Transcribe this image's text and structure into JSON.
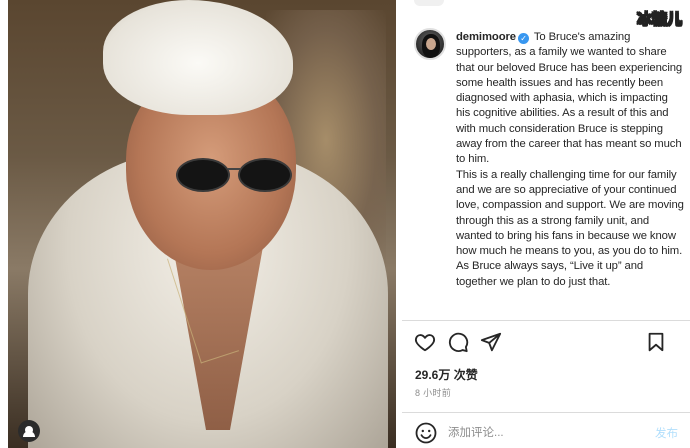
{
  "watermark": "冰糖儿",
  "post": {
    "username": "demimoore",
    "caption_lines": [
      "To Bruce's amazing supporters, as a family we wanted to share that our beloved Bruce has been experiencing some health issues and has recently been diagnosed with aphasia, which is impacting his cognitive abilities. As a result of this and with much consideration Bruce is stepping away from the career that has meant so much to him.",
      "This is a really challenging time for our family and we are so appreciative of your continued love, compassion and support. We are moving through this as a strong family unit, and wanted to bring his fans in because we know how much he means to you, as you do to him.",
      "As Bruce always says, “Live it up” and together we plan to do just that."
    ],
    "likes": "29.6万 次赞",
    "timestamp": "8 小时前"
  },
  "actions": {
    "like_icon": "heart-icon",
    "comment_icon": "comment-icon",
    "share_icon": "send-icon",
    "save_icon": "bookmark-icon"
  },
  "comment_bar": {
    "placeholder": "添加评论...",
    "post_label": "发布"
  },
  "colors": {
    "link_blue": "#3897f0",
    "post_button_disabled": "#b2dffc",
    "divider": "#dbdbdb"
  }
}
